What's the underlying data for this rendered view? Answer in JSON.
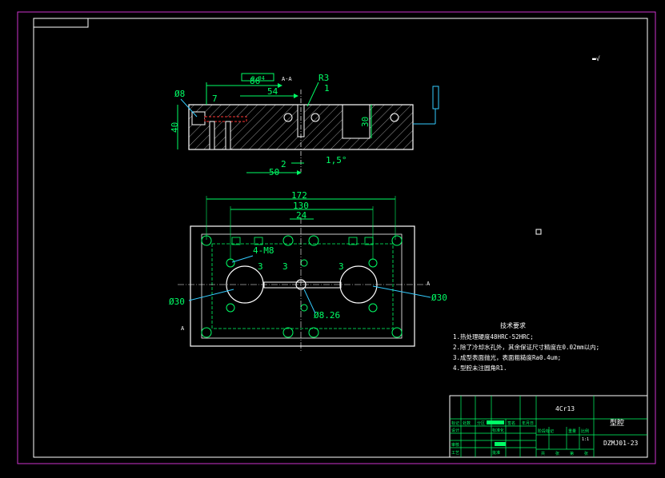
{
  "colors": {
    "background": "#000000",
    "outer_frame": "#cc33cc",
    "frame": "#ffffff",
    "part": "#ffffff",
    "dimension": "#00ff66",
    "leader": "#33ccff",
    "hidden": "#ff3333",
    "hatch": "#bbbbbb",
    "yellow": "#ffff33"
  },
  "side_view": {
    "dims": {
      "d86": "86",
      "d54": "54",
      "r3": "R3",
      "d1": "1",
      "dia8": "Ø8",
      "d7": "7",
      "d40": "40",
      "d30": "30",
      "d2": "2",
      "d50": "50",
      "ang": "1,5°",
      "flat_tol": "0.04"
    },
    "section_mark": "A-A"
  },
  "top_view": {
    "dims": {
      "d172": "172",
      "d130": "130",
      "d24": "24",
      "thread": "4-M8",
      "d3a": "3",
      "d3b": "3",
      "d3c": "3",
      "dia30a": "Ø30",
      "dia30b": "Ø30",
      "dia826": "Ø8.26"
    },
    "section_label": "A"
  },
  "notes": {
    "title": "技术要求",
    "items": [
      "1.热处理硬度48HRC-52HRC;",
      "2.除了冷却水孔外，其余保证尺寸精度在0.02mm以内;",
      "3.成型表面抛光，表面粗糙度Ra0.4um;",
      "4.型腔未注圆角R1."
    ]
  },
  "title_block": {
    "material": "4Cr13",
    "name": "型腔",
    "drawing_no": "DZMJ01-23",
    "scale": "1:1",
    "row_labels": [
      "设计",
      "审核",
      "工艺"
    ],
    "header_labels": [
      "标记",
      "处数",
      "分区",
      "签名",
      "年月日"
    ],
    "mid_labels": [
      "标准化",
      "批准"
    ],
    "stage_labels": [
      "阶段标记",
      "重量",
      "比例"
    ],
    "sheet_labels": [
      "共",
      "张",
      "第",
      "张"
    ]
  }
}
